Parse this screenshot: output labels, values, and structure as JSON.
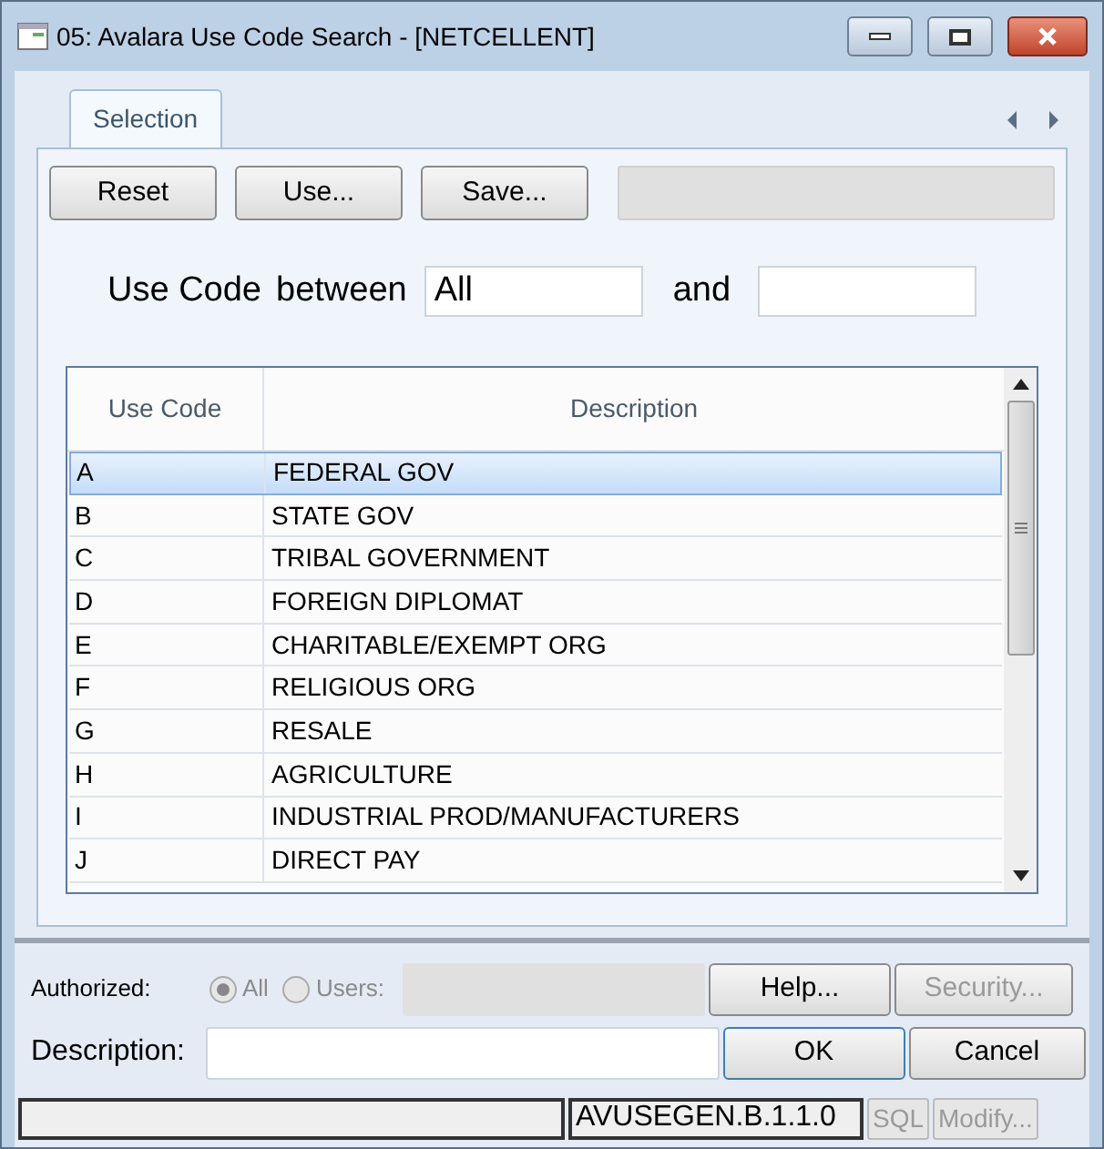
{
  "window": {
    "title": "05:  Avalara Use Code Search - [NETCELLENT]"
  },
  "tabs": [
    {
      "label": "Selection",
      "selected": true
    }
  ],
  "toolbar": {
    "buttons": [
      "Reset",
      "Use...",
      "Save..."
    ]
  },
  "range": {
    "label": "Use Code",
    "between": "between",
    "from": "All",
    "and": "and"
  },
  "table": {
    "columns": [
      "Use Code",
      "Description"
    ],
    "rows": [
      {
        "code": "A",
        "description": "FEDERAL GOV",
        "selected": true
      },
      {
        "code": "B",
        "description": "STATE GOV",
        "selected": false
      },
      {
        "code": "C",
        "description": "TRIBAL GOVERNMENT",
        "selected": false
      },
      {
        "code": "D",
        "description": "FOREIGN DIPLOMAT",
        "selected": false
      },
      {
        "code": "E",
        "description": "CHARITABLE/EXEMPT ORG",
        "selected": false
      },
      {
        "code": "F",
        "description": "RELIGIOUS ORG",
        "selected": false
      },
      {
        "code": "G",
        "description": "RESALE",
        "selected": false
      },
      {
        "code": "H",
        "description": "AGRICULTURE",
        "selected": false
      },
      {
        "code": "I",
        "description": "INDUSTRIAL PROD/MANUFACTURERS",
        "selected": false
      },
      {
        "code": "J",
        "description": "DIRECT PAY",
        "selected": false
      }
    ]
  },
  "authorized": {
    "label": "Authorized:",
    "options": [
      {
        "label": "All",
        "selected": true
      },
      {
        "label": "Users:",
        "selected": false
      }
    ]
  },
  "description": {
    "label": "Description:"
  },
  "buttons": [
    {
      "label": "Help...",
      "disabled": false,
      "default": false
    },
    {
      "label": "Security...",
      "disabled": true,
      "default": false
    },
    {
      "label": "OK",
      "disabled": false,
      "default": true
    },
    {
      "label": "Cancel",
      "disabled": false,
      "default": false
    }
  ],
  "status_bar": {
    "program": "AVUSEGEN.B.1.1.0",
    "buttons": [
      {
        "label": "SQL",
        "disabled": true
      },
      {
        "label": "Modify...",
        "disabled": true
      }
    ]
  }
}
